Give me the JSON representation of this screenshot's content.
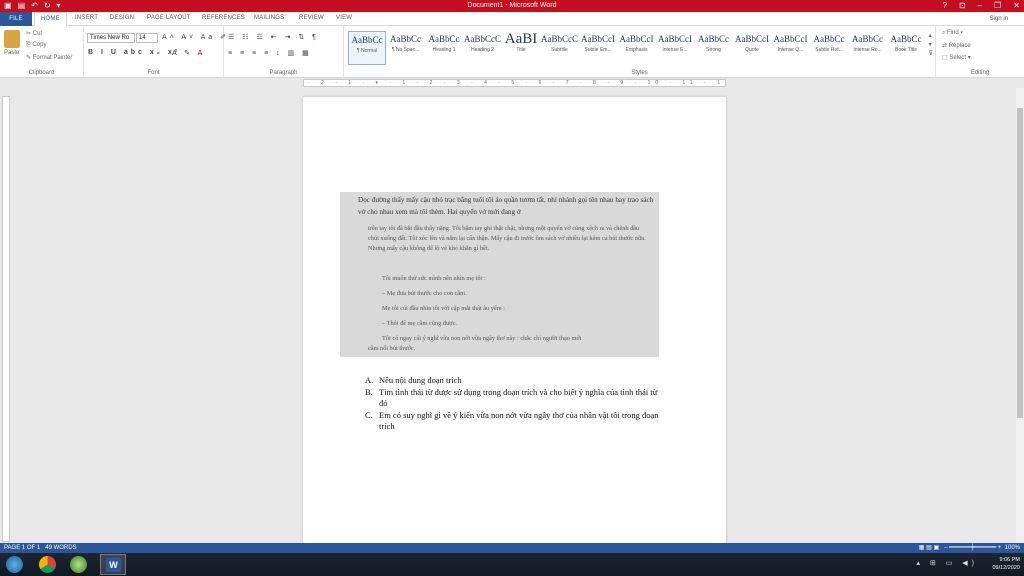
{
  "window": {
    "title": "Document1 - Microsoft Word",
    "controls": [
      "?",
      "⊡",
      "–",
      "❐",
      "✕"
    ]
  },
  "tabs": [
    "FILE",
    "HOME",
    "INSERT",
    "DESIGN",
    "PAGE LAYOUT",
    "REFERENCES",
    "MAILINGS",
    "REVIEW",
    "VIEW"
  ],
  "signin": "Sign in",
  "ribbon": {
    "clipboard": {
      "paste": "Paste",
      "cut": "Cut",
      "copy": "Copy",
      "format_painter": "Format Painter",
      "label": "Clipboard"
    },
    "font": {
      "font_name": "Times New Ro",
      "font_size": "14",
      "label": "Font"
    },
    "paragraph": {
      "label": "Paragraph"
    },
    "styles": {
      "label": "Styles",
      "items": [
        {
          "sample": "AaBbCc",
          "name": "¶ Normal"
        },
        {
          "sample": "AaBbCc",
          "name": "¶ No Spac..."
        },
        {
          "sample": "AaBbCc",
          "name": "Heading 1"
        },
        {
          "sample": "AaBbCcC",
          "name": "Heading 2"
        },
        {
          "sample": "AaBI",
          "name": "Title"
        },
        {
          "sample": "AaBbCcC",
          "name": "Subtitle"
        },
        {
          "sample": "AaBbCcI",
          "name": "Subtle Em..."
        },
        {
          "sample": "AaBbCcI",
          "name": "Emphasis"
        },
        {
          "sample": "AaBbCcI",
          "name": "Intense E..."
        },
        {
          "sample": "AaBbCc",
          "name": "Strong"
        },
        {
          "sample": "AaBbCcI",
          "name": "Quote"
        },
        {
          "sample": "AaBbCcI",
          "name": "Intense Q..."
        },
        {
          "sample": "AaBbCc",
          "name": "Subtle Ref..."
        },
        {
          "sample": "AaBbCc",
          "name": "Intense Re..."
        },
        {
          "sample": "AaBbCc",
          "name": "Book Title"
        }
      ]
    },
    "editing": {
      "find": "Find",
      "replace": "Replace",
      "select": "Select",
      "label": "Editing"
    }
  },
  "document": {
    "excerpt": {
      "p1": "Dọc đường thấy mấy cậu nhỏ trạc bằng tuổi tôi áo quần tươm tất, nhí nhảnh gọi tên nhau hay trao sách vở cho nhau xem mà tôi thèm. Hai quyển vở mới đang ở",
      "p2": "trên tay tôi đã bắt đầu thấy nặng. Tôi bặm tay ghì thật chặt, nhưng một quyển vở cũng xệch ra và chênh đầu chúi xuống đất. Tôi xóc lên và nắm lại cẩn thận. Mấy cậu đi trước ôm sách vở nhiều lại kèm cả bút thước nữa. Nhưng mấy cậu không để lộ vẻ khó khăn gì hết.",
      "l1": "Tôi muốn thử sức mình nên nhìn mẹ tôi :",
      "l2": "– Mẹ đưa bút thước cho con cầm.",
      "l3": "Mẹ tôi cúi đầu nhìn tôi với cặp mắt thật âu yếm :",
      "l4": "– Thôi để mẹ cầm cũng được.",
      "l5": "Tôi có ngay cái ý nghĩ vừa non nớt vừa ngây thơ này : chắc chỉ người thạo mới",
      "l6": "cầm nổi bút thước."
    },
    "questions": [
      {
        "letter": "A.",
        "text": "Nêu nội dung đoạn trích"
      },
      {
        "letter": "B.",
        "text": "Tìm tình thái từ được sử dụng trong đoạn trích và cho biết ý nghĩa của tình thái từ đó"
      },
      {
        "letter": "C.",
        "text": "Em có suy nghĩ gì về ý kiến vừa non nớt vừa ngây thơ của nhân vật tôi trong đoạn trích"
      }
    ]
  },
  "status": {
    "page": "PAGE 1 OF 1",
    "words": "49 WORDS",
    "zoom": "100%"
  },
  "taskbar": {
    "time": "9:06 PM",
    "date": "09/12/2020"
  }
}
